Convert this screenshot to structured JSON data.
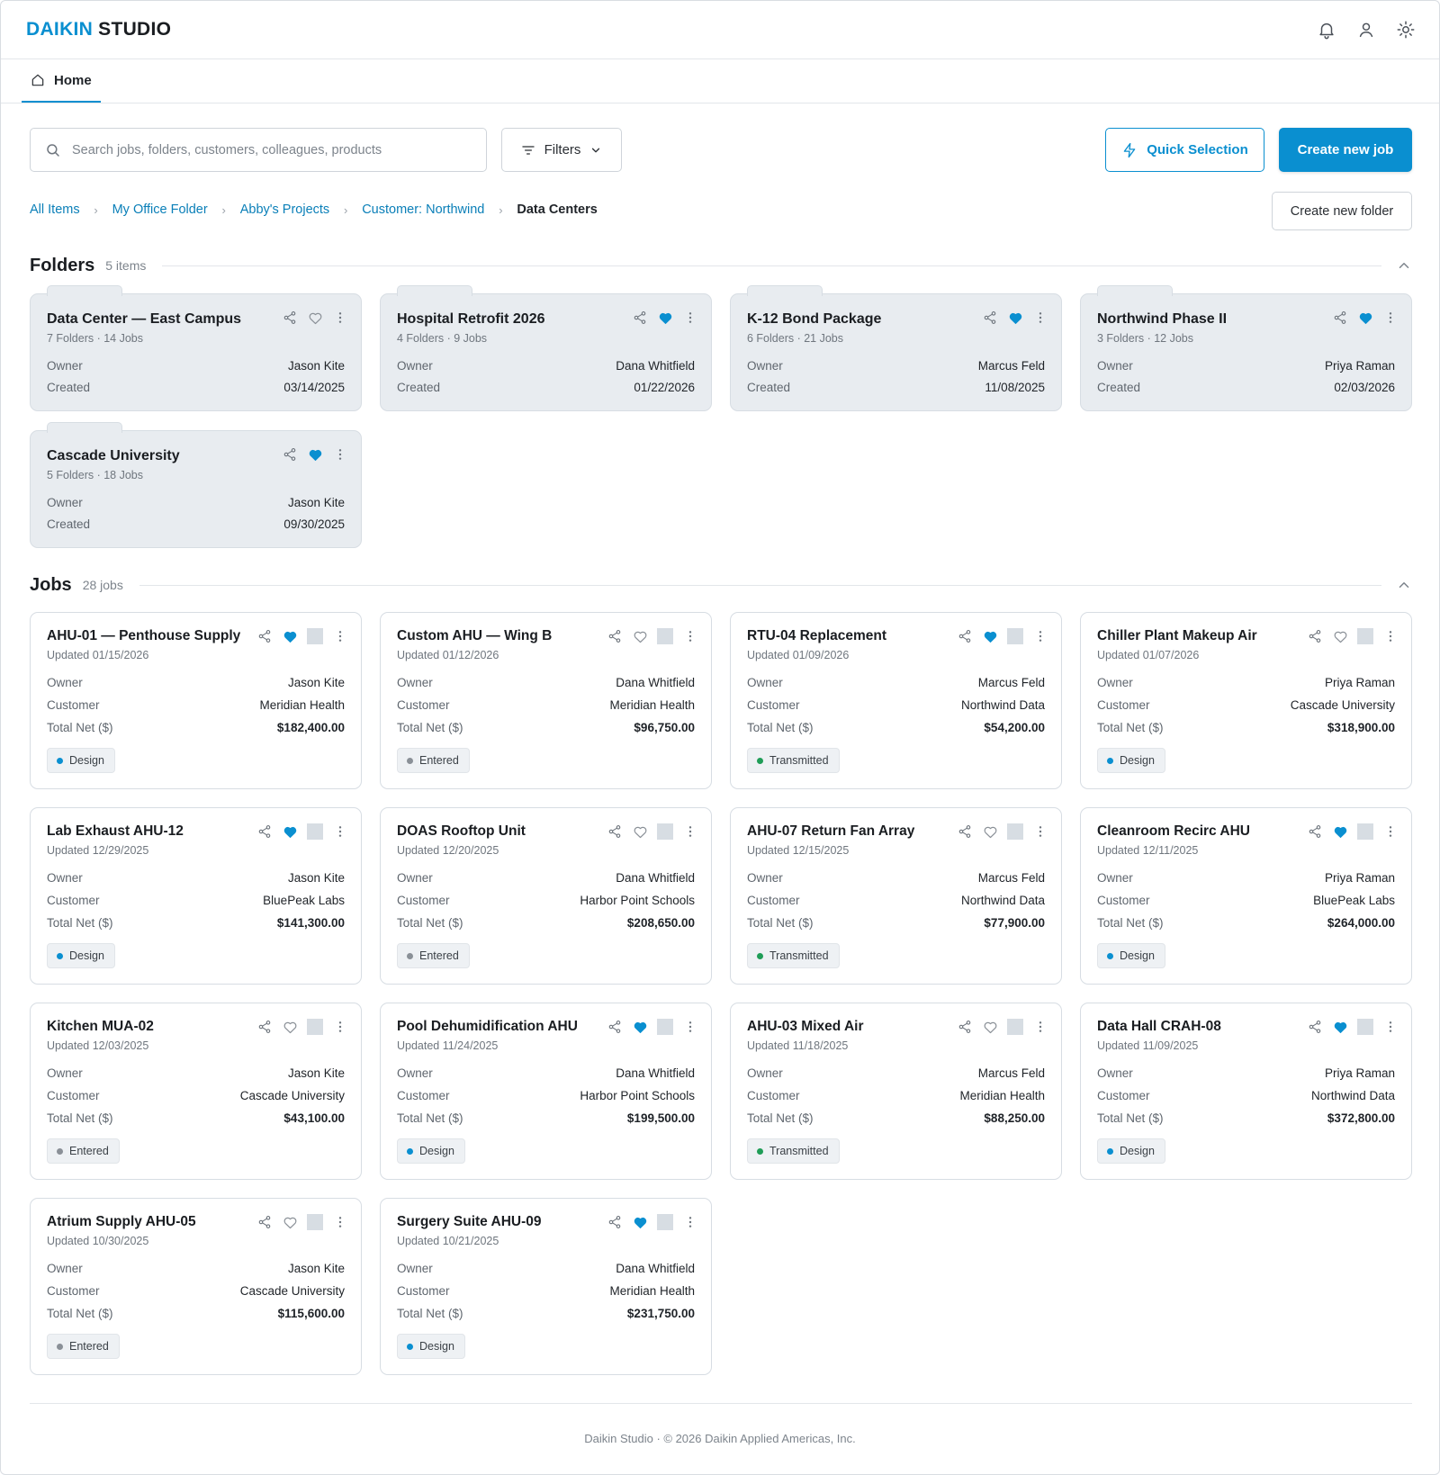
{
  "brand": {
    "part1": "DAIKIN",
    "part2": "STUDIO"
  },
  "header_icons": [
    "bell-icon",
    "user-icon",
    "settings-icon"
  ],
  "tabs": [
    {
      "label": "Home",
      "icon": "home-icon"
    }
  ],
  "search": {
    "placeholder": "Search jobs, folders, customers, colleagues, products"
  },
  "toolbar": {
    "filters_label": "Filters",
    "quick_selection_label": "Quick Selection",
    "create_job_label": "Create new job",
    "create_folder_label": "Create new folder"
  },
  "breadcrumb": {
    "items": [
      "All Items",
      "My Office Folder",
      "Abby's Projects",
      "Customer: Northwind"
    ],
    "current": "Data Centers"
  },
  "folders": {
    "title": "Folders",
    "count": "5 items",
    "owner_label": "Owner",
    "created_label": "Created",
    "items": [
      {
        "name": "Data Center — East Campus",
        "sub": "7 Folders · 14 Jobs",
        "owner": "Jason Kite",
        "created": "03/14/2025",
        "favorite": false
      },
      {
        "name": "Hospital Retrofit 2026",
        "sub": "4 Folders · 9 Jobs",
        "owner": "Dana Whitfield",
        "created": "01/22/2026",
        "favorite": true
      },
      {
        "name": "K-12 Bond Package",
        "sub": "6 Folders · 21 Jobs",
        "owner": "Marcus Feld",
        "created": "11/08/2025",
        "favorite": true
      },
      {
        "name": "Northwind Phase II",
        "sub": "3 Folders · 12 Jobs",
        "owner": "Priya Raman",
        "created": "02/03/2026",
        "favorite": true
      },
      {
        "name": "Cascade University",
        "sub": "5 Folders · 18 Jobs",
        "owner": "Jason Kite",
        "created": "09/30/2025",
        "favorite": true
      }
    ]
  },
  "jobs": {
    "title": "Jobs",
    "count": "28 jobs",
    "owner_label": "Owner",
    "customer_label": "Customer",
    "total_label": "Total Net ($)",
    "items": [
      {
        "name": "AHU-01 — Penthouse Supply",
        "updated": "Updated 01/15/2026",
        "owner": "Jason Kite",
        "customer": "Meridian Health",
        "total": "$182,400.00",
        "status": "Design",
        "favorite": true
      },
      {
        "name": "Custom AHU — Wing B",
        "updated": "Updated 01/12/2026",
        "owner": "Dana Whitfield",
        "customer": "Meridian Health",
        "total": "$96,750.00",
        "status": "Entered",
        "favorite": false
      },
      {
        "name": "RTU-04 Replacement",
        "updated": "Updated 01/09/2026",
        "owner": "Marcus Feld",
        "customer": "Northwind Data",
        "total": "$54,200.00",
        "status": "Transmitted",
        "favorite": true
      },
      {
        "name": "Chiller Plant Makeup Air",
        "updated": "Updated 01/07/2026",
        "owner": "Priya Raman",
        "customer": "Cascade University",
        "total": "$318,900.00",
        "status": "Design",
        "favorite": false
      },
      {
        "name": "Lab Exhaust AHU-12",
        "updated": "Updated 12/29/2025",
        "owner": "Jason Kite",
        "customer": "BluePeak Labs",
        "total": "$141,300.00",
        "status": "Design",
        "favorite": true
      },
      {
        "name": "DOAS Rooftop Unit",
        "updated": "Updated 12/20/2025",
        "owner": "Dana Whitfield",
        "customer": "Harbor Point Schools",
        "total": "$208,650.00",
        "status": "Entered",
        "favorite": false
      },
      {
        "name": "AHU-07 Return Fan Array",
        "updated": "Updated 12/15/2025",
        "owner": "Marcus Feld",
        "customer": "Northwind Data",
        "total": "$77,900.00",
        "status": "Transmitted",
        "favorite": false
      },
      {
        "name": "Cleanroom Recirc AHU",
        "updated": "Updated 12/11/2025",
        "owner": "Priya Raman",
        "customer": "BluePeak Labs",
        "total": "$264,000.00",
        "status": "Design",
        "favorite": true
      },
      {
        "name": "Kitchen MUA-02",
        "updated": "Updated 12/03/2025",
        "owner": "Jason Kite",
        "customer": "Cascade University",
        "total": "$43,100.00",
        "status": "Entered",
        "favorite": false
      },
      {
        "name": "Pool Dehumidification AHU",
        "updated": "Updated 11/24/2025",
        "owner": "Dana Whitfield",
        "customer": "Harbor Point Schools",
        "total": "$199,500.00",
        "status": "Design",
        "favorite": true
      },
      {
        "name": "AHU-03 Mixed Air",
        "updated": "Updated 11/18/2025",
        "owner": "Marcus Feld",
        "customer": "Meridian Health",
        "total": "$88,250.00",
        "status": "Transmitted",
        "favorite": false
      },
      {
        "name": "Data Hall CRAH-08",
        "updated": "Updated 11/09/2025",
        "owner": "Priya Raman",
        "customer": "Northwind Data",
        "total": "$372,800.00",
        "status": "Design",
        "favorite": true
      },
      {
        "name": "Atrium Supply AHU-05",
        "updated": "Updated 10/30/2025",
        "owner": "Jason Kite",
        "customer": "Cascade University",
        "total": "$115,600.00",
        "status": "Entered",
        "favorite": false
      },
      {
        "name": "Surgery Suite AHU-09",
        "updated": "Updated 10/21/2025",
        "owner": "Dana Whitfield",
        "customer": "Meridian Health",
        "total": "$231,750.00",
        "status": "Design",
        "favorite": true
      }
    ]
  },
  "status_colors": {
    "Design": "#0a8fd0",
    "Entered": "#8a9097",
    "Transmitted": "#1f9d57"
  },
  "colors": {
    "accent": "#0a8fd0",
    "card_bg": "#e8ecf0",
    "favorite": "#0a8fd0"
  },
  "footer": "Daikin Studio · © 2026 Daikin Applied Americas, Inc."
}
